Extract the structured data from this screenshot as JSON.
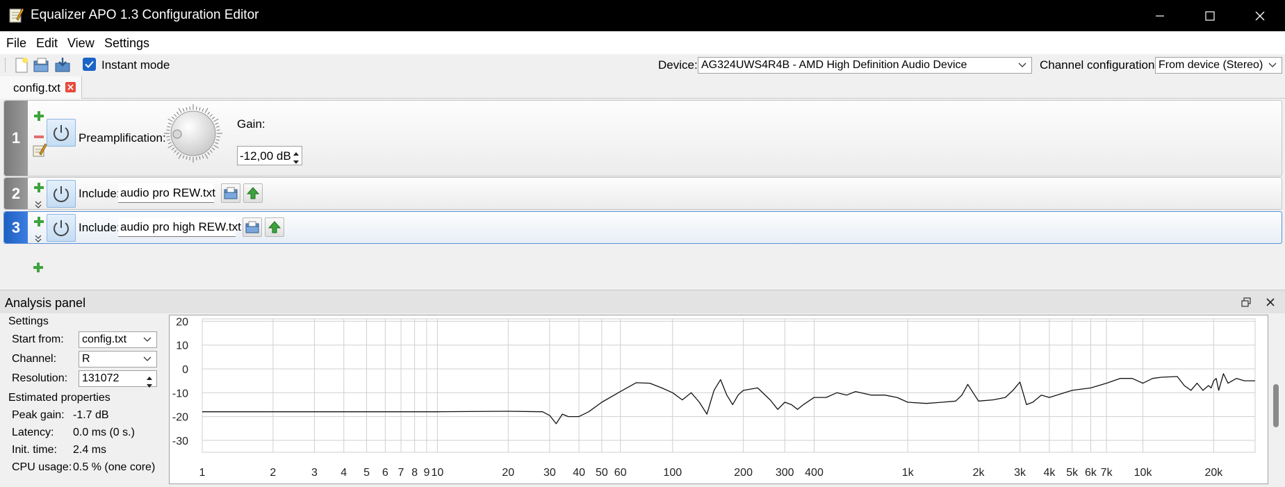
{
  "window": {
    "title": "Equalizer APO 1.3 Configuration Editor"
  },
  "menu": {
    "file": "File",
    "edit": "Edit",
    "view": "View",
    "settings": "Settings"
  },
  "toolbar": {
    "instant_mode_label": "Instant mode",
    "instant_mode_checked": true,
    "device_label": "Device:",
    "device_value": "AG324UWS4R4B - AMD High Definition Audio Device",
    "channel_config_label": "Channel configuration:",
    "channel_config_value": "From device (Stereo)"
  },
  "tabs": [
    {
      "label": "config.txt"
    }
  ],
  "filters": {
    "row1": {
      "number": "1",
      "label": "Preamplification:",
      "gain_label": "Gain:",
      "gain_value": "-12,00 dB"
    },
    "row2": {
      "number": "2",
      "label": "Include:",
      "file": "audio pro REW.txt"
    },
    "row3": {
      "number": "3",
      "label": "Include:",
      "file": "audio pro high REW.txt"
    }
  },
  "analysis": {
    "title": "Analysis panel",
    "settings_title": "Settings",
    "start_from_label": "Start from:",
    "start_from_value": "config.txt",
    "channel_label": "Channel:",
    "channel_value": "R",
    "resolution_label": "Resolution:",
    "resolution_value": "131072",
    "estimated_title": "Estimated properties",
    "peak_gain_label": "Peak gain:",
    "peak_gain_value": "-1.7 dB",
    "latency_label": "Latency:",
    "latency_value": "0.0 ms (0 s.)",
    "init_time_label": "Init. time:",
    "init_time_value": "2.4 ms",
    "cpu_label": "CPU usage:",
    "cpu_value": "0.5 % (one core)"
  },
  "chart_data": {
    "type": "line",
    "x_scale": "log",
    "xlim": [
      1,
      30000
    ],
    "ylim": [
      -35,
      21
    ],
    "y_ticks": [
      20,
      10,
      0,
      -10,
      -20,
      -30
    ],
    "x_ticks": [
      {
        "v": 1,
        "label": "1"
      },
      {
        "v": 2,
        "label": "2"
      },
      {
        "v": 3,
        "label": "3"
      },
      {
        "v": 4,
        "label": "4"
      },
      {
        "v": 5,
        "label": "5"
      },
      {
        "v": 6,
        "label": "6"
      },
      {
        "v": 7,
        "label": "7"
      },
      {
        "v": 8,
        "label": "8"
      },
      {
        "v": 9,
        "label": "9"
      },
      {
        "v": 10,
        "label": "10"
      },
      {
        "v": 20,
        "label": "20"
      },
      {
        "v": 30,
        "label": "30"
      },
      {
        "v": 40,
        "label": "40"
      },
      {
        "v": 50,
        "label": "50"
      },
      {
        "v": 60,
        "label": "60"
      },
      {
        "v": 100,
        "label": "100"
      },
      {
        "v": 200,
        "label": "200"
      },
      {
        "v": 300,
        "label": "300"
      },
      {
        "v": 400,
        "label": "400"
      },
      {
        "v": 1000,
        "label": "1k"
      },
      {
        "v": 2000,
        "label": "2k"
      },
      {
        "v": 3000,
        "label": "3k"
      },
      {
        "v": 4000,
        "label": "4k"
      },
      {
        "v": 5000,
        "label": "5k"
      },
      {
        "v": 6000,
        "label": "6k"
      },
      {
        "v": 7000,
        "label": "7k"
      },
      {
        "v": 10000,
        "label": "10k"
      },
      {
        "v": 20000,
        "label": "20k"
      }
    ],
    "grid": true,
    "series": [
      {
        "x": [
          1,
          5,
          10,
          20,
          28,
          30,
          32,
          34,
          36,
          40,
          44,
          50,
          60,
          70,
          80,
          90,
          100,
          110,
          120,
          130,
          140,
          150,
          160,
          170,
          180,
          190,
          200,
          230,
          260,
          280,
          300,
          320,
          340,
          360,
          400,
          450,
          500,
          550,
          600,
          700,
          800,
          900,
          1000,
          1200,
          1400,
          1600,
          1700,
          1800,
          2000,
          2300,
          2600,
          2800,
          3000,
          3200,
          3400,
          3700,
          4000,
          5000,
          6000,
          7000,
          8000,
          9000,
          10000,
          11000,
          12000,
          14000,
          15000,
          16000,
          17000,
          18000,
          19000,
          19500,
          20000,
          20500,
          21000,
          22000,
          23000,
          24000,
          25000,
          27000,
          30000
        ],
        "y": [
          -18,
          -18,
          -18,
          -17.8,
          -18,
          -19.5,
          -23,
          -19,
          -20,
          -20,
          -18,
          -14,
          -9.5,
          -5.8,
          -6,
          -8,
          -10,
          -13,
          -10,
          -14,
          -19,
          -9,
          -4.5,
          -11,
          -15,
          -11,
          -9,
          -8,
          -13,
          -17,
          -14,
          -15,
          -17,
          -15,
          -12,
          -12,
          -10,
          -11,
          -9.5,
          -11,
          -11,
          -12,
          -14,
          -14.5,
          -14,
          -13.5,
          -11,
          -6.5,
          -13.5,
          -13,
          -12,
          -9,
          -5.5,
          -15,
          -14,
          -11,
          -12,
          -9,
          -8,
          -6,
          -4,
          -4,
          -6,
          -4,
          -3.5,
          -3.2,
          -7,
          -9,
          -6,
          -9,
          -7,
          -8,
          -5,
          -4,
          -9,
          -2,
          -6,
          -5,
          -4,
          -5,
          -5
        ]
      }
    ]
  }
}
